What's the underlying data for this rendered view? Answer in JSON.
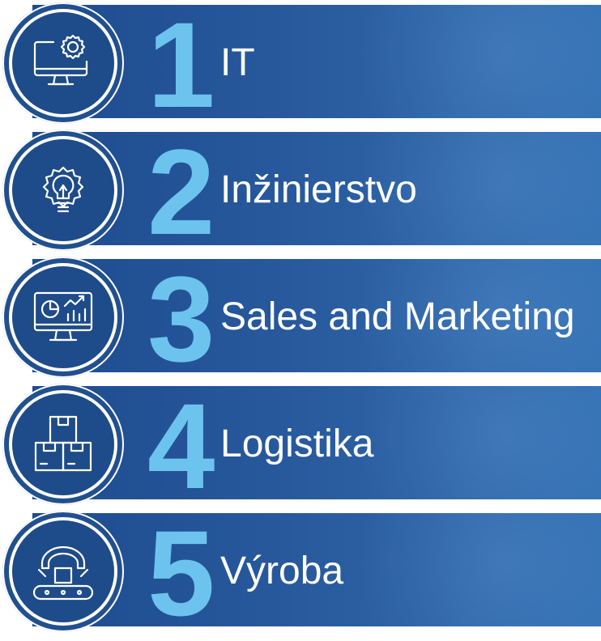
{
  "items": [
    {
      "number": "1",
      "label": "IT",
      "icon": "monitor-gear-icon"
    },
    {
      "number": "2",
      "label": "Inžinierstvo",
      "icon": "lightbulb-gear-icon"
    },
    {
      "number": "3",
      "label": "Sales and Marketing",
      "icon": "monitor-analytics-icon"
    },
    {
      "number": "4",
      "label": "Logistika",
      "icon": "stacked-boxes-icon"
    },
    {
      "number": "5",
      "label": "Výroba",
      "icon": "robot-arm-conveyor-icon"
    }
  ],
  "colors": {
    "band": "#28599c",
    "number": "#6cc4ee",
    "text": "#ffffff"
  }
}
